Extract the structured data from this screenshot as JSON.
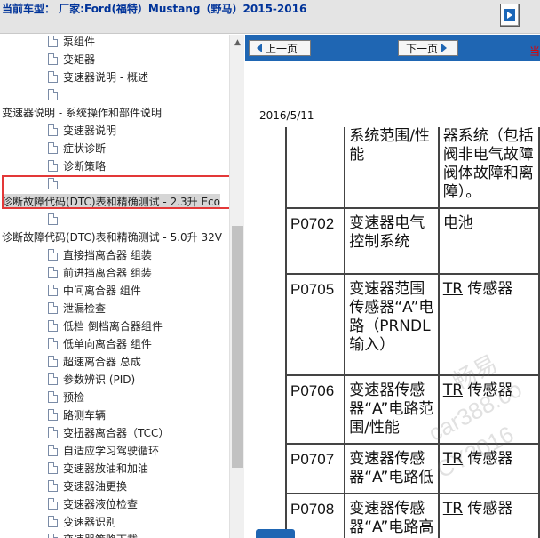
{
  "header": {
    "title": "当前车型： 厂家:Ford(福特）Mustang（野马）2015-2016",
    "nav_icon": "forward-play-icon"
  },
  "tree": {
    "items": [
      {
        "label": "泵组件",
        "indent": 2,
        "icon": true
      },
      {
        "label": "变矩器",
        "indent": 2,
        "icon": true
      },
      {
        "label": "变速器说明 - 概述",
        "indent": 2,
        "icon": true
      },
      {
        "label": "",
        "indent": 2,
        "icon": true
      },
      {
        "label": "变速器说明 - 系统操作和部件说明",
        "indent": 0,
        "icon": false
      },
      {
        "label": "变速器说明",
        "indent": 2,
        "icon": true
      },
      {
        "label": "症状诊断",
        "indent": 2,
        "icon": true
      },
      {
        "label": "诊断策略",
        "indent": 2,
        "icon": true
      },
      {
        "label": "",
        "indent": 2,
        "icon": true
      },
      {
        "label": "诊断故障代码(DTC)表和精确测试 - 2.3升 Eco",
        "indent": 0,
        "icon": false,
        "selected": true
      },
      {
        "label": "",
        "indent": 2,
        "icon": true
      },
      {
        "label": "诊断故障代码(DTC)表和精确测试 - 5.0升 32V",
        "indent": 0,
        "icon": false
      },
      {
        "label": "直接挡离合器 组装",
        "indent": 2,
        "icon": true
      },
      {
        "label": "前进挡离合器 组装",
        "indent": 2,
        "icon": true
      },
      {
        "label": "中间离合器 组件",
        "indent": 2,
        "icon": true
      },
      {
        "label": "泄漏检查",
        "indent": 2,
        "icon": true
      },
      {
        "label": "低档 倒档离合器组件",
        "indent": 2,
        "icon": true
      },
      {
        "label": "低单向离合器 组件",
        "indent": 2,
        "icon": true
      },
      {
        "label": "超速离合器 总成",
        "indent": 2,
        "icon": true
      },
      {
        "label": "参数辨识 (PID)",
        "indent": 2,
        "icon": true
      },
      {
        "label": "预检",
        "indent": 2,
        "icon": true
      },
      {
        "label": "路测车辆",
        "indent": 2,
        "icon": true
      },
      {
        "label": "变扭器离合器（TCC）",
        "indent": 2,
        "icon": true
      },
      {
        "label": "自适应学习驾驶循环",
        "indent": 2,
        "icon": true
      },
      {
        "label": "变速器放油和加油",
        "indent": 2,
        "icon": true
      },
      {
        "label": "变速器油更换",
        "indent": 2,
        "icon": true
      },
      {
        "label": "变速器液位检查",
        "indent": 2,
        "icon": true
      },
      {
        "label": "变速器识别",
        "indent": 2,
        "icon": true
      },
      {
        "label": "变速器策略下载",
        "indent": 2,
        "icon": true
      }
    ]
  },
  "pager": {
    "prev_label": "上一页",
    "next_label": "下一页",
    "right_mark": "当"
  },
  "doc": {
    "date": "2016/5/11",
    "rows": [
      {
        "code": "",
        "desc": "系统范围/性能",
        "cause": "器系统（包括阀非电气故障阀体故障和离障）。"
      },
      {
        "code": "P0702",
        "desc": "变速器电气控制系统",
        "cause": "电池"
      },
      {
        "code": "P0705",
        "desc": "变速器范围传感器“A”电路（PRNDL输入）",
        "cause_tr": "TR",
        "cause": " 传感器"
      },
      {
        "code": "P0706",
        "desc": "变速器传感器“A”电路范围/性能",
        "cause_tr": "TR",
        "cause": " 传感器"
      },
      {
        "code": "P0707",
        "desc": "变速器传感器“A”电路低",
        "cause_tr": "TR",
        "cause": " 传感器"
      },
      {
        "code": "P0708",
        "desc": "变速器传感器“A”电路高",
        "cause_tr": "TR",
        "cause": " 传感器"
      }
    ],
    "watermarks": [
      "畅易",
      "car388.co",
      "CY2016"
    ]
  },
  "colors": {
    "accent_blue": "#1f66b3",
    "title_blue": "#003399",
    "highlight_red": "#e33838"
  }
}
